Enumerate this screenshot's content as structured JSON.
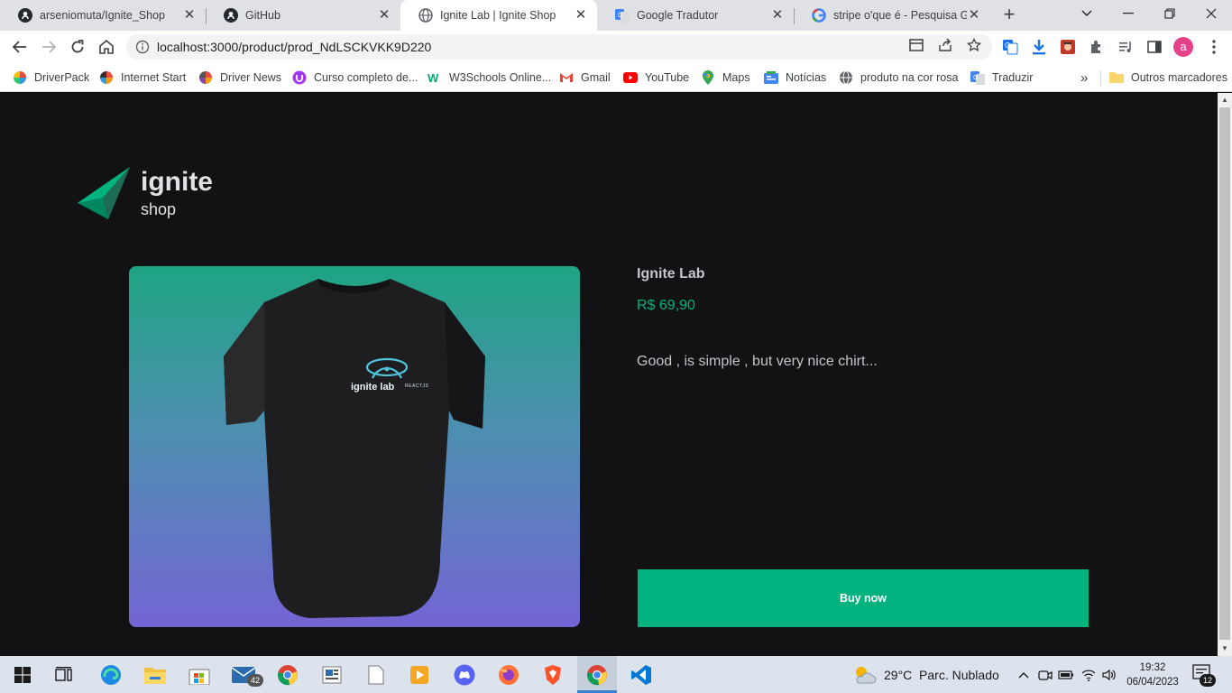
{
  "browser": {
    "tabs": [
      {
        "title": "arseniomuta/Ignite_Shop",
        "icon": "github-icon",
        "active": false
      },
      {
        "title": "GitHub",
        "icon": "github-icon",
        "active": false
      },
      {
        "title": "Ignite Lab | Ignite Shop",
        "icon": "globe-icon",
        "active": true
      },
      {
        "title": "Google Tradutor",
        "icon": "google-translate-icon",
        "active": false
      },
      {
        "title": "stripe o'que é - Pesquisa Goo",
        "icon": "google-icon",
        "active": false
      }
    ],
    "close_glyph": "✕",
    "new_tab_glyph": "+",
    "url": "localhost:3000/product/prod_NdLSCKVKK9D220",
    "profile_initial": "a",
    "bookmarks": [
      {
        "label": "DriverPack",
        "icon": "driverpack-icon"
      },
      {
        "label": "Internet Start",
        "icon": "internet-start-icon"
      },
      {
        "label": "Driver News",
        "icon": "driver-news-icon"
      },
      {
        "label": "Curso completo de...",
        "icon": "udemy-icon"
      },
      {
        "label": "W3Schools Online...",
        "icon": "w3schools-icon"
      },
      {
        "label": "Gmail",
        "icon": "gmail-icon"
      },
      {
        "label": "YouTube",
        "icon": "youtube-icon"
      },
      {
        "label": "Maps",
        "icon": "maps-icon"
      },
      {
        "label": "Notícias",
        "icon": "news-icon"
      },
      {
        "label": "produto na cor rosa",
        "icon": "globe-icon"
      },
      {
        "label": "Traduzir",
        "icon": "google-translate-icon"
      }
    ],
    "bookmarks_overflow": "»",
    "other_bookmarks": "Outros marcadores"
  },
  "shop": {
    "logo_word": "ignite",
    "logo_sub": "shop",
    "product": {
      "name": "Ignite Lab",
      "price": "R$ 69,90",
      "description": "Good , is simple , but very nice chirt...",
      "shirt_print": "ignite lab",
      "shirt_print_tag": "REACTJS"
    },
    "buy_label": "Buy now"
  },
  "taskbar": {
    "mail_badge": "42",
    "weather_text": "29°C  Parc. Nublado",
    "time": "19:32",
    "date": "06/04/2023",
    "notification_count": "12"
  },
  "colors": {
    "page_bg": "#121214",
    "accent": "#00b37e",
    "text": "#c4c4cc",
    "gradient_top": "#1ea483",
    "gradient_bottom": "#7465d4"
  }
}
